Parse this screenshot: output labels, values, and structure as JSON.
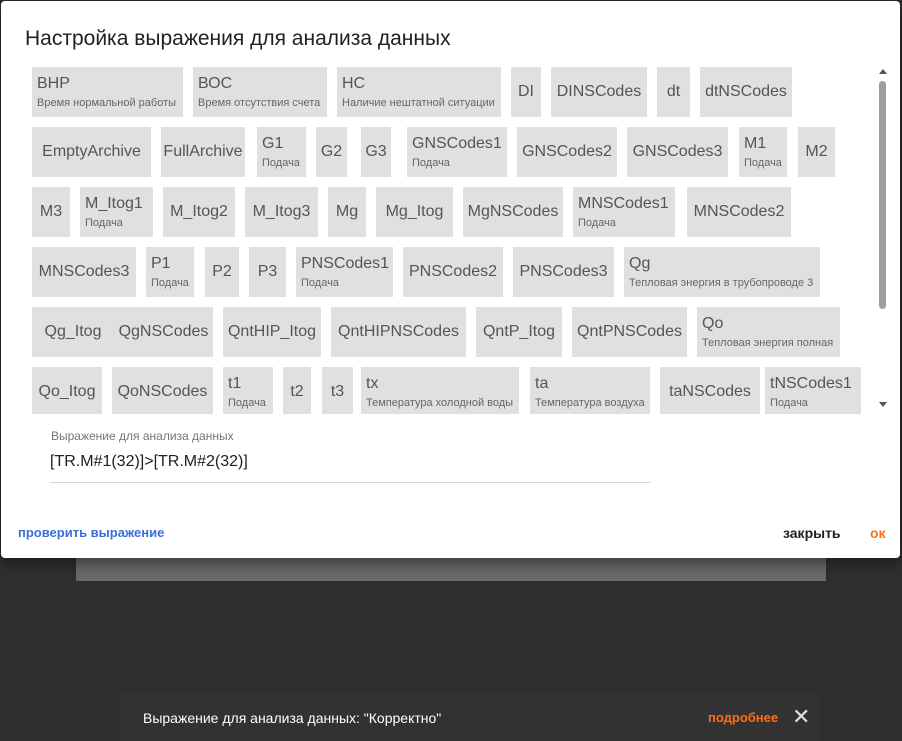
{
  "dialog": {
    "title": "Настройка выражения для анализа данных",
    "chips": [
      {
        "label": "ВНР",
        "sub": "Время нормальной работы"
      },
      {
        "label": "ВОС",
        "sub": "Время отсутствия счета"
      },
      {
        "label": "НС",
        "sub": "Наличие нештатной ситуации"
      },
      {
        "label": "DI"
      },
      {
        "label": "DINSCodes"
      },
      {
        "label": "dt"
      },
      {
        "label": "dtNSCodes"
      },
      {
        "label": "EmptyArchive"
      },
      {
        "label": "FullArchive"
      },
      {
        "label": "G1",
        "sub": "Подача"
      },
      {
        "label": "G2"
      },
      {
        "label": "G3"
      },
      {
        "label": "GNSCodes1",
        "sub": "Подача"
      },
      {
        "label": "GNSCodes2"
      },
      {
        "label": "GNSCodes3"
      },
      {
        "label": "M1",
        "sub": "Подача"
      },
      {
        "label": "M2"
      },
      {
        "label": "M3"
      },
      {
        "label": "M_Itog1",
        "sub": "Подача"
      },
      {
        "label": "M_Itog2"
      },
      {
        "label": "M_Itog3"
      },
      {
        "label": "Mg"
      },
      {
        "label": "Mg_Itog"
      },
      {
        "label": "MgNSCodes"
      },
      {
        "label": "MNSCodes1",
        "sub": "Подача"
      },
      {
        "label": "MNSCodes2"
      },
      {
        "label": "MNSCodes3"
      },
      {
        "label": "P1",
        "sub": "Подача"
      },
      {
        "label": "P2"
      },
      {
        "label": "P3"
      },
      {
        "label": "PNSCodes1",
        "sub": "Подача"
      },
      {
        "label": "PNSCodes2"
      },
      {
        "label": "PNSCodes3"
      },
      {
        "label": "Qg",
        "sub": "Тепловая энергия в трубопроводе 3"
      },
      {
        "label": "Qg_Itog"
      },
      {
        "label": "QgNSCodes"
      },
      {
        "label": "QntHIP_Itog"
      },
      {
        "label": "QntHIPNSCodes"
      },
      {
        "label": "QntP_Itog"
      },
      {
        "label": "QntPNSCodes"
      },
      {
        "label": "Qo",
        "sub": "Тепловая энергия полная"
      },
      {
        "label": "Qo_Itog"
      },
      {
        "label": "QoNSCodes"
      },
      {
        "label": "t1",
        "sub": "Подача"
      },
      {
        "label": "t2"
      },
      {
        "label": "t3"
      },
      {
        "label": "tx",
        "sub": "Температура холодной воды"
      },
      {
        "label": "ta",
        "sub": "Температура воздуха"
      },
      {
        "label": "taNSCodes"
      },
      {
        "label": "tNSCodes1",
        "sub": "Подача"
      }
    ],
    "field": {
      "label": "Выражение для анализа данных",
      "value": "[TR.M#1(32)]>[TR.M#2(32)]"
    },
    "actions": {
      "check": "проверить выражение",
      "close": "закрыть",
      "ok": "ок"
    }
  },
  "snackbar": {
    "text": "Выражение для анализа данных: \"Корректно\"",
    "more": "подробнее",
    "close_icon": "close-icon"
  },
  "colors": {
    "accent": "#ff6e16",
    "link": "#3b6fd6",
    "chip_bg": "#e0e0e0"
  }
}
